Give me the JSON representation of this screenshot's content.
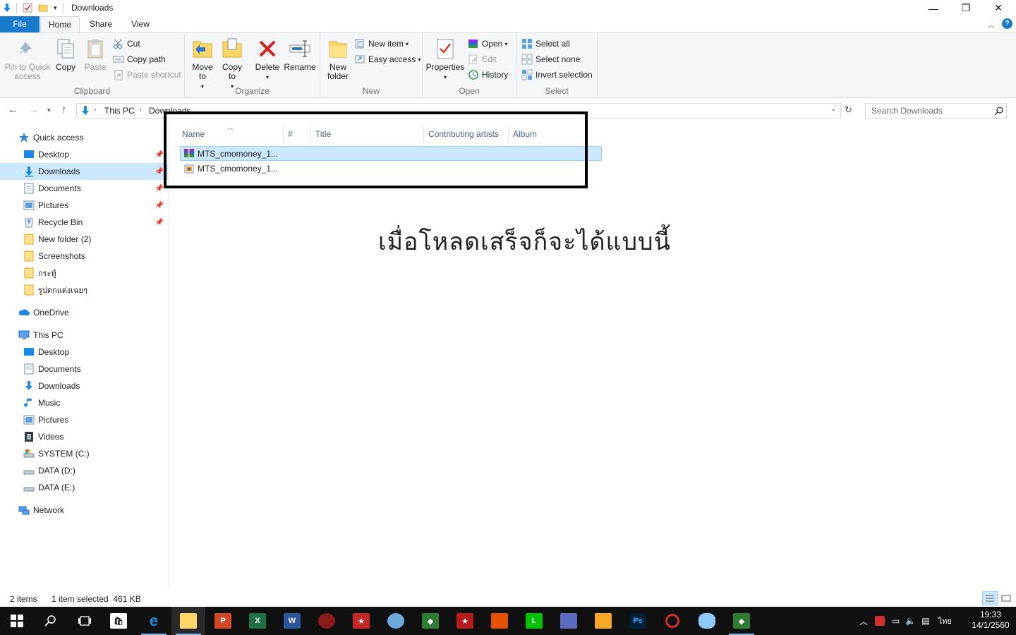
{
  "window": {
    "title": "Downloads",
    "controls": {
      "minimize": "—",
      "maximize": "❐",
      "close": "✕"
    }
  },
  "ribbon_tabs": [
    "File",
    "Home",
    "Share",
    "View"
  ],
  "ribbon": {
    "clipboard": {
      "label": "Clipboard",
      "pin": "Pin to Quick access",
      "copy": "Copy",
      "paste": "Paste",
      "cut": "Cut",
      "copy_path": "Copy path",
      "paste_shortcut": "Paste shortcut"
    },
    "organize": {
      "label": "Organize",
      "move_to": "Move to",
      "copy_to": "Copy to",
      "delete": "Delete",
      "rename": "Rename"
    },
    "new": {
      "label": "New",
      "new_folder": "New folder",
      "new_item": "New item",
      "easy_access": "Easy access"
    },
    "open": {
      "label": "Open",
      "properties": "Properties",
      "open": "Open",
      "edit": "Edit",
      "history": "History"
    },
    "select": {
      "label": "Select",
      "select_all": "Select all",
      "select_none": "Select none",
      "invert_selection": "Invert selection"
    }
  },
  "address": {
    "crumbs": [
      "This PC",
      "Downloads"
    ],
    "search_placeholder": "Search Downloads"
  },
  "sidebar": {
    "quick_access": "Quick access",
    "quick_items": [
      "Desktop",
      "Downloads",
      "Documents",
      "Pictures",
      "Recycle Bin",
      "New folder (2)",
      "Screenshots",
      "กระทู้",
      "รูปตกแต่งเฉยๆ"
    ],
    "onedrive": "OneDrive",
    "this_pc": "This PC",
    "pc_items": [
      "Desktop",
      "Documents",
      "Downloads",
      "Music",
      "Pictures",
      "Videos",
      "SYSTEM (C:)",
      "DATA (D:)",
      "DATA (E:)"
    ],
    "network": "Network"
  },
  "columns": [
    "Name",
    "#",
    "Title",
    "Contributing artists",
    "Album"
  ],
  "files": [
    {
      "name": "MTS_cmomoney_1...",
      "type": "archive",
      "selected": true
    },
    {
      "name": "MTS_cmomoney_1...",
      "type": "package",
      "selected": false
    }
  ],
  "annotation_text": "เมื่อโหลดเสร็จก็จะได้แบบนี้",
  "status": {
    "count": "2 items",
    "selection": "1 item selected  461 KB"
  },
  "taskbar": {
    "time": "19:33",
    "date": "14/1/2560",
    "language": "ไทย"
  },
  "colors": {
    "accent": "#1979ca",
    "selection": "#cce8ff",
    "taskbar": "#101010"
  }
}
